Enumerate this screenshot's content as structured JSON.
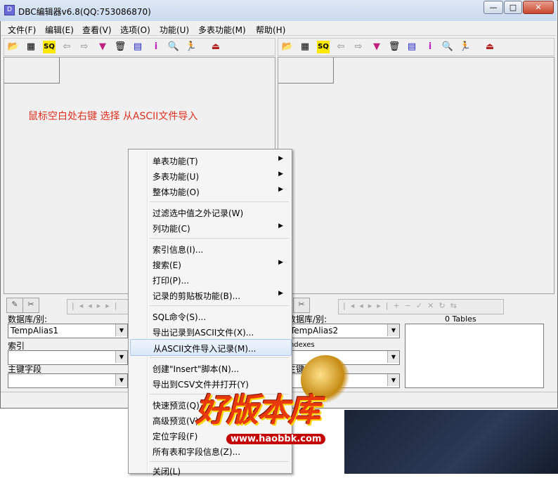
{
  "window": {
    "title": "DBC编辑器v6.8(QQ:753086870)"
  },
  "window_buttons": {
    "minimize": "—",
    "maximize": "□",
    "close": "✕"
  },
  "menubar": [
    "文件(F)",
    "编辑(E)",
    "查看(V)",
    "选项(O)",
    "功能(U)",
    "多表功能(M)",
    "帮助(H)"
  ],
  "hint_text": "鼠标空白处右键 选择 从ASCII文件导入",
  "left_panel": {
    "db_label": "数据库/别:",
    "db_value": "TempAlias1",
    "index_label": "索引",
    "pk_label": "主键字段"
  },
  "right_panel": {
    "db_label": "数据库/别:",
    "db_value": "TempAlias2",
    "index_label": "Indexes",
    "pk_label": "主键",
    "tables_count": "0 Tables"
  },
  "context_menu": {
    "groups": [
      [
        {
          "label": "单表功能(T)",
          "submenu": true
        },
        {
          "label": "多表功能(U)",
          "submenu": true
        },
        {
          "label": "整体功能(O)",
          "submenu": true
        }
      ],
      [
        {
          "label": "过滤选中值之外记录(W)",
          "submenu": false
        },
        {
          "label": "列功能(C)",
          "submenu": true
        }
      ],
      [
        {
          "label": "索引信息(I)...",
          "submenu": false
        },
        {
          "label": "搜索(E)",
          "submenu": true
        },
        {
          "label": "打印(P)...",
          "submenu": false
        },
        {
          "label": "记录的剪贴板功能(B)...",
          "submenu": true
        }
      ],
      [
        {
          "label": "SQL命令(S)...",
          "submenu": false
        },
        {
          "label": "导出记录到ASCII文件(X)...",
          "submenu": false
        },
        {
          "label": "从ASCII文件导入记录(M)...",
          "submenu": false,
          "highlighted": true
        }
      ],
      [
        {
          "label": "创建\"Insert\"脚本(N)...",
          "submenu": false
        },
        {
          "label": "导出到CSV文件并打开(Y)",
          "submenu": false
        }
      ],
      [
        {
          "label": "快速预览(Q)",
          "submenu": false
        },
        {
          "label": "高级预览(V)",
          "submenu": false
        },
        {
          "label": "定位字段(F)",
          "submenu": false
        },
        {
          "label": "所有表和字段信息(Z)...",
          "submenu": false
        }
      ],
      [
        {
          "label": "关闭(L)",
          "submenu": false
        }
      ]
    ]
  },
  "watermark": {
    "title": "好版本库",
    "url": "www.haobbk.com"
  },
  "icons": {
    "open": "📂",
    "grid": "▦",
    "sql": "SQ",
    "back": "⇦",
    "export": "⇨",
    "filter": "▼",
    "delete": "🗑",
    "table": "▤",
    "info": "i",
    "search": "🔍",
    "run": "🏃",
    "exit": "⏏"
  }
}
